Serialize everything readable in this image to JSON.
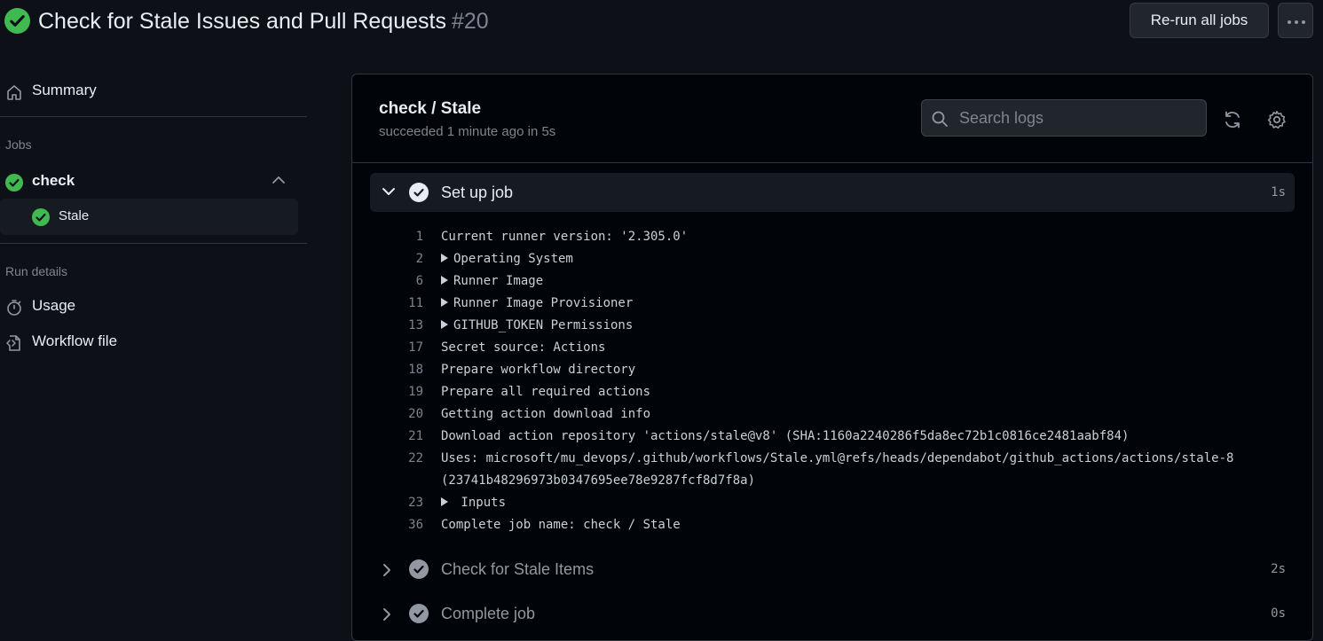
{
  "header": {
    "title": "Check for Stale Issues and Pull Requests",
    "run_number": "#20",
    "rerun_label": "Re-run all jobs"
  },
  "sidebar": {
    "summary_label": "Summary",
    "jobs_heading": "Jobs",
    "job_name": "check",
    "sub_job_name": "Stale",
    "run_details_heading": "Run details",
    "usage_label": "Usage",
    "workflow_file_label": "Workflow file"
  },
  "main": {
    "job_title": "check / Stale",
    "job_status": "succeeded 1 minute ago in 5s",
    "search_placeholder": "Search logs",
    "steps": [
      {
        "label": "Set up job",
        "duration": "1s"
      },
      {
        "label": "Check for Stale Items",
        "duration": "2s"
      },
      {
        "label": "Complete job",
        "duration": "0s"
      }
    ],
    "log_lines": [
      {
        "num": "1",
        "text": "Current runner version: '2.305.0'"
      },
      {
        "num": "2",
        "text": "Operating System"
      },
      {
        "num": "6",
        "text": "Runner Image"
      },
      {
        "num": "11",
        "text": "Runner Image Provisioner"
      },
      {
        "num": "13",
        "text": "GITHUB_TOKEN Permissions"
      },
      {
        "num": "17",
        "text": "Secret source: Actions"
      },
      {
        "num": "18",
        "text": "Prepare workflow directory"
      },
      {
        "num": "19",
        "text": "Prepare all required actions"
      },
      {
        "num": "20",
        "text": "Getting action download info"
      },
      {
        "num": "21",
        "text": "Download action repository 'actions/stale@v8' (SHA:1160a2240286f5da8ec72b1c0816ce2481aabf84)"
      },
      {
        "num": "22",
        "text": "Uses: microsoft/mu_devops/.github/workflows/Stale.yml@refs/heads/dependabot/github_actions/actions/stale-8"
      },
      {
        "num": "",
        "text": "(23741b48296973b0347695ee78e9287fcf8d7f8a)"
      },
      {
        "num": "23",
        "text": " Inputs"
      },
      {
        "num": "36",
        "text": "Complete job name: check / Stale"
      }
    ]
  },
  "colors": {
    "success": "#3fb950",
    "background": "#0d1117",
    "panel": "#010409"
  }
}
